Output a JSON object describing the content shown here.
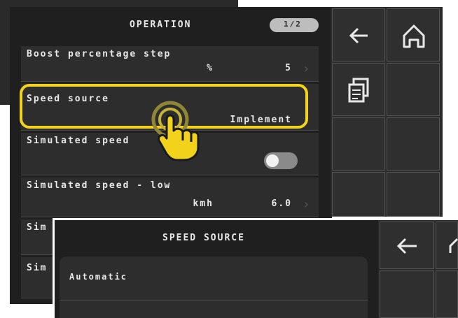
{
  "colors": {
    "highlight": "#f2d21b",
    "screen_bg": "#1f1f1f",
    "row_bg": "#2d2d2d",
    "text": "#e8e8e8"
  },
  "back_panel": {
    "title": "OPERATION",
    "page_badge": "1/2",
    "rows": [
      {
        "label": "Boost percentage step",
        "unit": "%",
        "value": "5"
      },
      {
        "label": "Speed source",
        "unit": "",
        "value": "Implement"
      },
      {
        "label": "Simulated speed",
        "toggle": "off"
      },
      {
        "label": "Simulated speed - low",
        "unit": "kmh",
        "value": "6.0"
      },
      {
        "label": "Sim"
      },
      {
        "label": "Sim"
      }
    ],
    "nav": {
      "back_icon": "arrow-left-icon",
      "home_icon": "home-icon",
      "copy_icon": "copy-icon"
    }
  },
  "front_panel": {
    "title": "SPEED SOURCE",
    "options": [
      {
        "label": "Automatic"
      }
    ],
    "nav": {
      "back_icon": "arrow-left-icon"
    }
  },
  "overlay": {
    "hand_icon": "tap-hand-icon"
  }
}
